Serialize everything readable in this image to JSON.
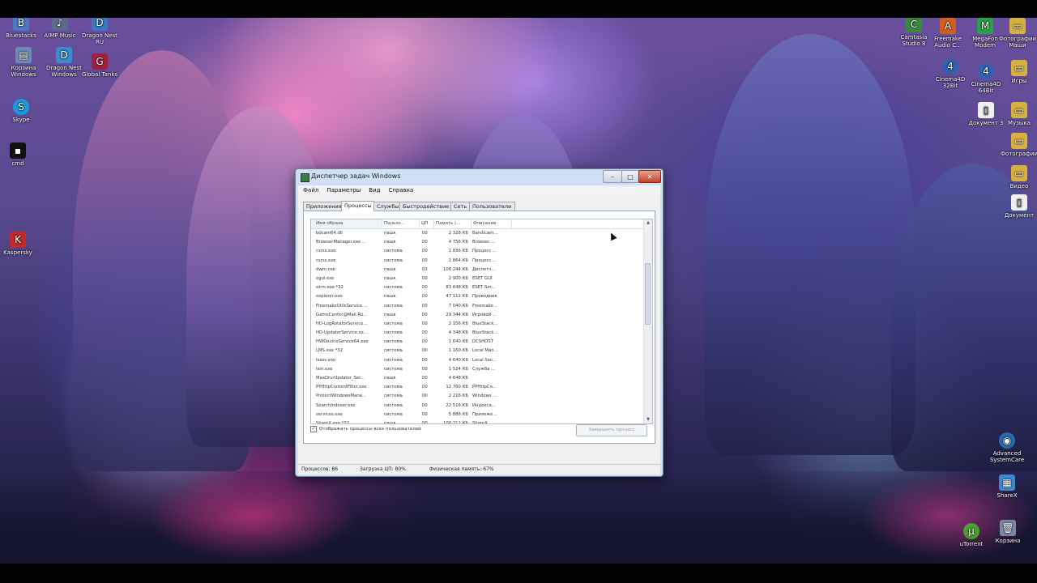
{
  "desktop_icons": [
    {
      "id": "icon-1",
      "label": "Bluestacks",
      "glyph": "B",
      "color": "#4a78c4"
    },
    {
      "id": "icon-2",
      "label": "AIMP Music",
      "glyph": "♪",
      "color": "#5a6a8a"
    },
    {
      "id": "icon-3",
      "label": "Dragon Nest RU",
      "glyph": "D",
      "color": "#3a7ac0"
    },
    {
      "id": "icon-4",
      "label": "Корзина Windows",
      "glyph": "▤",
      "color": "#6c8bb6"
    },
    {
      "id": "icon-5",
      "label": "Dragon Nest Windows",
      "glyph": "D",
      "color": "#3a8ad0"
    },
    {
      "id": "icon-6",
      "label": "Global Tanks",
      "glyph": "G",
      "color": "#a02040"
    },
    {
      "id": "icon-7",
      "label": "Skype",
      "glyph": "S",
      "color": "#1a9ae0"
    },
    {
      "id": "icon-8",
      "label": "cmd",
      "glyph": "▪",
      "color": "#111111"
    },
    {
      "id": "icon-9",
      "label": "Kaspersky",
      "glyph": "K",
      "color": "#c02a2a"
    },
    {
      "id": "icon-10",
      "label": "Camtasia Studio 8",
      "glyph": "C",
      "color": "#3a8a3a"
    },
    {
      "id": "icon-11",
      "label": "Freemake Audio C...",
      "glyph": "A",
      "color": "#d06020"
    },
    {
      "id": "icon-12",
      "label": "MegaFon Modem",
      "glyph": "M",
      "color": "#2aa04a"
    },
    {
      "id": "icon-13",
      "label": "Фотографии Маши",
      "glyph": "▭",
      "color": "#d8b040"
    },
    {
      "id": "icon-14",
      "label": "Cinema4D 32Bit",
      "glyph": "4",
      "color": "#3060b0"
    },
    {
      "id": "icon-15",
      "label": "Cinema4D 64Bit",
      "glyph": "4",
      "color": "#3060b0"
    },
    {
      "id": "icon-16",
      "label": "Игры",
      "glyph": "▭",
      "color": "#d8b040"
    },
    {
      "id": "icon-17",
      "label": "Документ 3",
      "glyph": "▯",
      "color": "#f0f0f0"
    },
    {
      "id": "icon-18",
      "label": "Музыка",
      "glyph": "▭",
      "color": "#d8b040"
    },
    {
      "id": "icon-19",
      "label": "Фотографии",
      "glyph": "▭",
      "color": "#d8b040"
    },
    {
      "id": "icon-20",
      "label": "Видео",
      "glyph": "▭",
      "color": "#d8b040"
    },
    {
      "id": "icon-21",
      "label": "Документ",
      "glyph": "▯",
      "color": "#f0f0f0"
    },
    {
      "id": "icon-22",
      "label": "Advanced SystemCare",
      "glyph": "◉",
      "color": "#2a6ab0"
    },
    {
      "id": "icon-23",
      "label": "ShareX",
      "glyph": "▦",
      "color": "#3a8ad0"
    },
    {
      "id": "icon-24",
      "label": "uTorrent",
      "glyph": "μ",
      "color": "#4aa030"
    },
    {
      "id": "icon-25",
      "label": "Корзина",
      "glyph": "🗑",
      "color": "#7a8aa0"
    }
  ],
  "window": {
    "title": "Диспетчер задач Windows",
    "controls": {
      "minimize": "–",
      "maximize": "□",
      "close": "✕"
    },
    "menu": [
      "Файл",
      "Параметры",
      "Вид",
      "Справка"
    ],
    "tabs": [
      "Приложения",
      "Процессы",
      "Службы",
      "Быстродействие",
      "Сеть",
      "Пользователи"
    ],
    "active_tab": "Процессы",
    "columns": [
      "Имя образа",
      "Пользо...",
      "ЦП",
      "Память (...",
      "Описание"
    ],
    "rows": [
      [
        "bdcam64.dll",
        "пашк",
        "00",
        "2 328 КБ",
        "Bandicam..."
      ],
      [
        "BrowserManager.exe ...",
        "пашк",
        "00",
        "4 756 КБ",
        "Browser ..."
      ],
      [
        "csrss.exe",
        "система",
        "00",
        "1 836 КБ",
        "Процесс ..."
      ],
      [
        "csrss.exe",
        "система",
        "00",
        "1 864 КБ",
        "Процесс ..."
      ],
      [
        "dwm.exe",
        "пашк",
        "03",
        "108 244 КБ",
        "Диспетч..."
      ],
      [
        "egui.exe",
        "пашк",
        "00",
        "2 900 КБ",
        "ESET GUI"
      ],
      [
        "ekrn.exe *32",
        "система",
        "00",
        "83 648 КБ",
        "ESET Ser..."
      ],
      [
        "explorer.exe",
        "пашк",
        "00",
        "47 112 КБ",
        "Проводник"
      ],
      [
        "FreemakeUtilsService....",
        "система",
        "00",
        "7 040 КБ",
        "Freemake..."
      ],
      [
        "GameCenter@Mail.Ru...",
        "пашк",
        "00",
        "29 344 КБ",
        "Игровой ..."
      ],
      [
        "HD-LogRotatorService...",
        "система",
        "00",
        "2 156 КБ",
        "BlueStack..."
      ],
      [
        "HD-UpdaterService.ex...",
        "система",
        "00",
        "4 348 КБ",
        "BlueStack..."
      ],
      [
        "HWDeviceService64.exe",
        "система",
        "00",
        "1 640 КБ",
        "DCSHOST"
      ],
      [
        "LMS.exe *32",
        "система",
        "00",
        "1 160 КБ",
        "Local Man..."
      ],
      [
        "lsass.exe",
        "система",
        "00",
        "4 640 КБ",
        "Local Sec..."
      ],
      [
        "lsm.exe",
        "система",
        "00",
        "1 524 КБ",
        "Служба ..."
      ],
      [
        "MaxDrvrUpdater_Ser...",
        "пашк",
        "00",
        "4 648 КБ",
        ""
      ],
      [
        "PPHttpContentFilter.exe",
        "система",
        "00",
        "12 760 КБ",
        "PPHttpCo..."
      ],
      [
        "ProtectWindowsMana...",
        "система",
        "00",
        "2 216 КБ",
        "Windows ..."
      ],
      [
        "SearchIndexer.exe",
        "система",
        "00",
        "22 516 КБ",
        "Индекса..."
      ],
      [
        "services.exe",
        "система",
        "00",
        "5 888 КБ",
        "Приложе..."
      ],
      [
        "ShareX.exe *32",
        "пашк",
        "00",
        "100 212 КБ",
        "ShareX"
      ]
    ],
    "show_all_processes_label": "Отображать процессы всех пользователей",
    "show_all_checked": "✓",
    "end_process_label": "Завершить процесс",
    "status": {
      "processes": "Процессов: 86",
      "cpu": "Загрузка ЦП: 80%",
      "memory": "Физическая память: 67%"
    }
  },
  "colors": {
    "accent": "#cfe0f2",
    "close": "#c3432a"
  }
}
